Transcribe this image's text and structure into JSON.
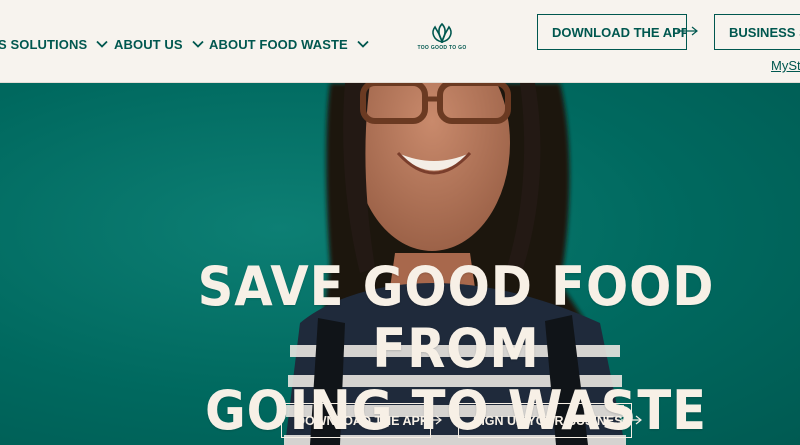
{
  "nav": {
    "items": [
      {
        "label": "S SOLUTIONS"
      },
      {
        "label": "ABOUT US"
      },
      {
        "label": "ABOUT FOOD WASTE"
      }
    ]
  },
  "logo": {
    "text": "TOO GOOD TO GO"
  },
  "header": {
    "download_label": "DOWNLOAD THE APP",
    "business_label": "BUSINESS SIG",
    "account_link": "MySt"
  },
  "hero": {
    "headline_line1": "SAVE GOOD FOOD FROM",
    "headline_line2": "GOING TO WASTE",
    "download_label": "DOWNLOAD THE APP",
    "signup_label": "SIGN UP YOUR BUSINESS"
  },
  "colors": {
    "brand_green": "#00574f",
    "hero_teal": "#006b62",
    "cream": "#f7f3ee"
  }
}
